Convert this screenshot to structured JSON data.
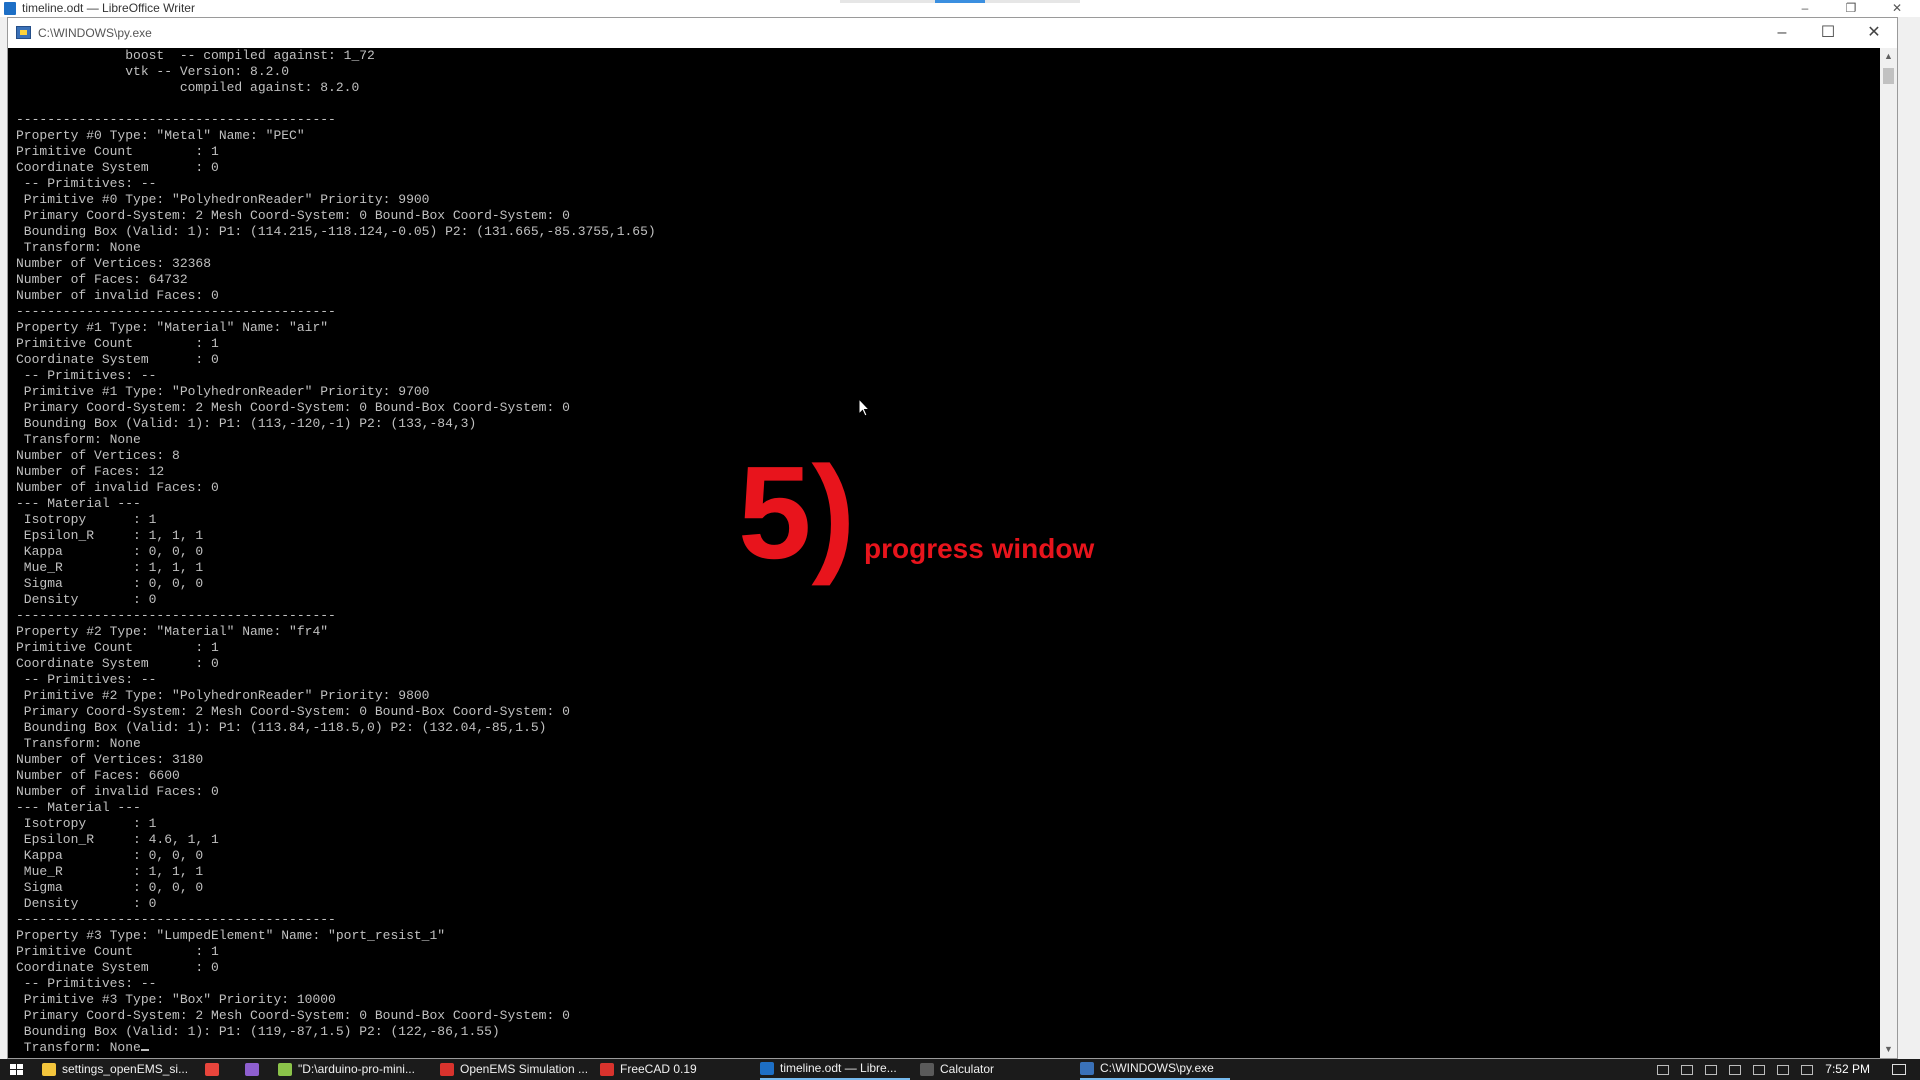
{
  "bg_window": {
    "title": "timeline.odt — LibreOffice Writer",
    "controls": [
      "–",
      "❐",
      "✕"
    ]
  },
  "console": {
    "title": "C:\\WINDOWS\\py.exe",
    "controls": [
      "–",
      "☐",
      "✕"
    ],
    "scroll_up": "▲",
    "scroll_down": "▼",
    "lines": [
      "              boost  -- compiled against: 1_72",
      "              vtk -- Version: 8.2.0",
      "                     compiled against: 8.2.0",
      "",
      "-----------------------------------------",
      "Property #0 Type: \"Metal\" Name: \"PEC\"",
      "Primitive Count        : 1",
      "Coordinate System      : 0",
      " -- Primitives: --",
      " Primitive #0 Type: \"PolyhedronReader\" Priority: 9900",
      " Primary Coord-System: 2 Mesh Coord-System: 0 Bound-Box Coord-System: 0",
      " Bounding Box (Valid: 1): P1: (114.215,-118.124,-0.05) P2: (131.665,-85.3755,1.65)",
      " Transform: None",
      "Number of Vertices: 32368",
      "Number of Faces: 64732",
      "Number of invalid Faces: 0",
      "-----------------------------------------",
      "Property #1 Type: \"Material\" Name: \"air\"",
      "Primitive Count        : 1",
      "Coordinate System      : 0",
      " -- Primitives: --",
      " Primitive #1 Type: \"PolyhedronReader\" Priority: 9700",
      " Primary Coord-System: 2 Mesh Coord-System: 0 Bound-Box Coord-System: 0",
      " Bounding Box (Valid: 1): P1: (113,-120,-1) P2: (133,-84,3)",
      " Transform: None",
      "Number of Vertices: 8",
      "Number of Faces: 12",
      "Number of invalid Faces: 0",
      "--- Material ---",
      " Isotropy      : 1",
      " Epsilon_R     : 1, 1, 1",
      " Kappa         : 0, 0, 0",
      " Mue_R         : 1, 1, 1",
      " Sigma         : 0, 0, 0",
      " Density       : 0",
      "-----------------------------------------",
      "Property #2 Type: \"Material\" Name: \"fr4\"",
      "Primitive Count        : 1",
      "Coordinate System      : 0",
      " -- Primitives: --",
      " Primitive #2 Type: \"PolyhedronReader\" Priority: 9800",
      " Primary Coord-System: 2 Mesh Coord-System: 0 Bound-Box Coord-System: 0",
      " Bounding Box (Valid: 1): P1: (113.84,-118.5,0) P2: (132.04,-85,1.5)",
      " Transform: None",
      "Number of Vertices: 3180",
      "Number of Faces: 6600",
      "Number of invalid Faces: 0",
      "--- Material ---",
      " Isotropy      : 1",
      " Epsilon_R     : 4.6, 1, 1",
      " Kappa         : 0, 0, 0",
      " Mue_R         : 1, 1, 1",
      " Sigma         : 0, 0, 0",
      " Density       : 0",
      "-----------------------------------------",
      "Property #3 Type: \"LumpedElement\" Name: \"port_resist_1\"",
      "Primitive Count        : 1",
      "Coordinate System      : 0",
      " -- Primitives: --",
      " Primitive #3 Type: \"Box\" Priority: 10000",
      " Primary Coord-System: 2 Mesh Coord-System: 0 Bound-Box Coord-System: 0",
      " Bounding Box (Valid: 1): P1: (119,-87,1.5) P2: (122,-86,1.55)",
      " Transform: None"
    ]
  },
  "overlay": {
    "number": "5)",
    "caption": "progress window",
    "color": "#e8141c"
  },
  "taskbar": {
    "tasks": [
      {
        "label": "settings_openEMS_si...",
        "icon": "folder-icon",
        "color": "#f3c53c"
      },
      {
        "label": "",
        "icon": "chrome-icon",
        "color": "#e8453c"
      },
      {
        "label": "",
        "icon": "app-icon",
        "color": "#8e5fcf"
      },
      {
        "label": "\"D:\\arduino-pro-mini...",
        "icon": "notepad-icon",
        "color": "#8bc34a"
      },
      {
        "label": "OpenEMS Simulation ...",
        "icon": "freecad-icon",
        "color": "#d9332d"
      },
      {
        "label": "FreeCAD 0.19",
        "icon": "freecad-icon",
        "color": "#d9332d"
      },
      {
        "label": "timeline.odt — Libre...",
        "icon": "writer-icon",
        "color": "#1d6fc6"
      },
      {
        "label": "Calculator",
        "icon": "calculator-icon",
        "color": "#5a5a5a"
      },
      {
        "label": "C:\\WINDOWS\\py.exe",
        "icon": "python-icon",
        "color": "#3a71b8"
      }
    ],
    "clock": "7:52 PM"
  }
}
